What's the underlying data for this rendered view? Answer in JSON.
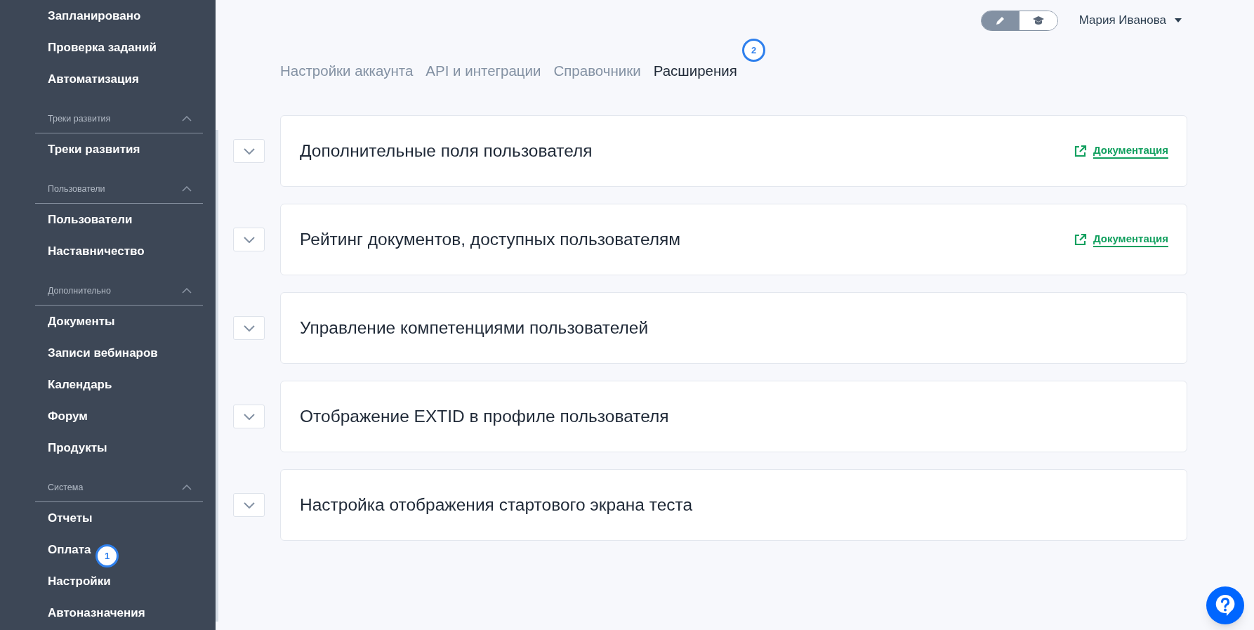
{
  "sidebar": {
    "top_items": [
      "Запланировано",
      "Проверка заданий",
      "Автоматизация"
    ],
    "sections": [
      {
        "title": "Треки развития",
        "expanded": true,
        "items": [
          "Треки развития"
        ]
      },
      {
        "title": "Пользователи",
        "expanded": true,
        "items": [
          "Пользователи",
          "Наставничество"
        ]
      },
      {
        "title": "Дополнительно",
        "expanded": true,
        "items": [
          "Документы",
          "Записи вебинаров",
          "Календарь",
          "Форум",
          "Продукты"
        ]
      },
      {
        "title": "Система",
        "expanded": true,
        "items": [
          "Отчеты",
          "Оплата",
          "Настройки",
          "Автоназначения"
        ]
      }
    ]
  },
  "mode_toggle": [
    {
      "kind": "edit",
      "selected": true
    },
    {
      "kind": "learn",
      "selected": false
    }
  ],
  "user": {
    "name": "Мария Иванова"
  },
  "tabs": [
    {
      "label": "Настройки аккаунта",
      "selected": false
    },
    {
      "label": "API и интеграции",
      "selected": false
    },
    {
      "label": "Справочники",
      "selected": false
    },
    {
      "label": "Расширения",
      "selected": true
    }
  ],
  "extensions": [
    {
      "title": "Дополнительные поля пользователя",
      "expanded": false,
      "doc_link": "Документация"
    },
    {
      "title": "Рейтинг документов, доступных пользователям",
      "expanded": false,
      "doc_link": "Документация"
    },
    {
      "title": "Управление компетенциями пользователей",
      "expanded": false
    },
    {
      "title": "Отображение EXTID в профиле пользователя",
      "expanded": false
    },
    {
      "title": "Настройка отображения стартового экрана теста",
      "expanded": false
    }
  ],
  "annotations": [
    {
      "label": "1"
    },
    {
      "label": "2"
    }
  ]
}
